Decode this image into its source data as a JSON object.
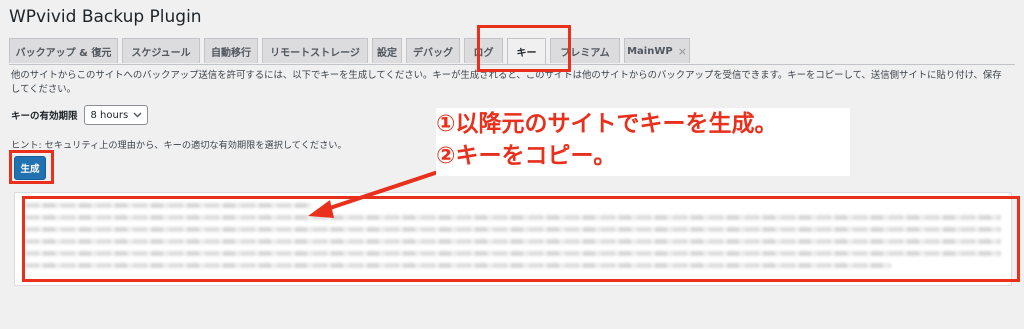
{
  "app": {
    "title": "WPvivid Backup Plugin"
  },
  "tabs": [
    {
      "label": "バックアップ & 復元"
    },
    {
      "label": "スケジュール"
    },
    {
      "label": "自動移行"
    },
    {
      "label": "リモートストレージ"
    },
    {
      "label": "設定"
    },
    {
      "label": "デバッグ"
    },
    {
      "label": "ログ"
    },
    {
      "label": "キー"
    },
    {
      "label": "プレミアム"
    },
    {
      "label": "MainWP",
      "close": "×"
    }
  ],
  "description": "他のサイトからこのサイトへのバックアップ送信を許可するには、以下でキーを生成してください。キーが生成されると、このサイトは他のサイトからのバックアップを受信できます。キーをコピーして、送信側サイトに貼り付け、保存してください。",
  "expiry": {
    "label": "キーの有効期限",
    "value": "8 hours"
  },
  "hint": "ヒント: セキュリティ上の理由から、キーの適切な有効期限を選択してください。",
  "generate_button": "生成",
  "annotation": {
    "line1": "①以降元のサイトでキーを生成。",
    "line2": "②キーをコピー。",
    "color": "#e8301c"
  },
  "colors": {
    "primary_button": "#2271b1",
    "highlight": "#e8301c"
  }
}
